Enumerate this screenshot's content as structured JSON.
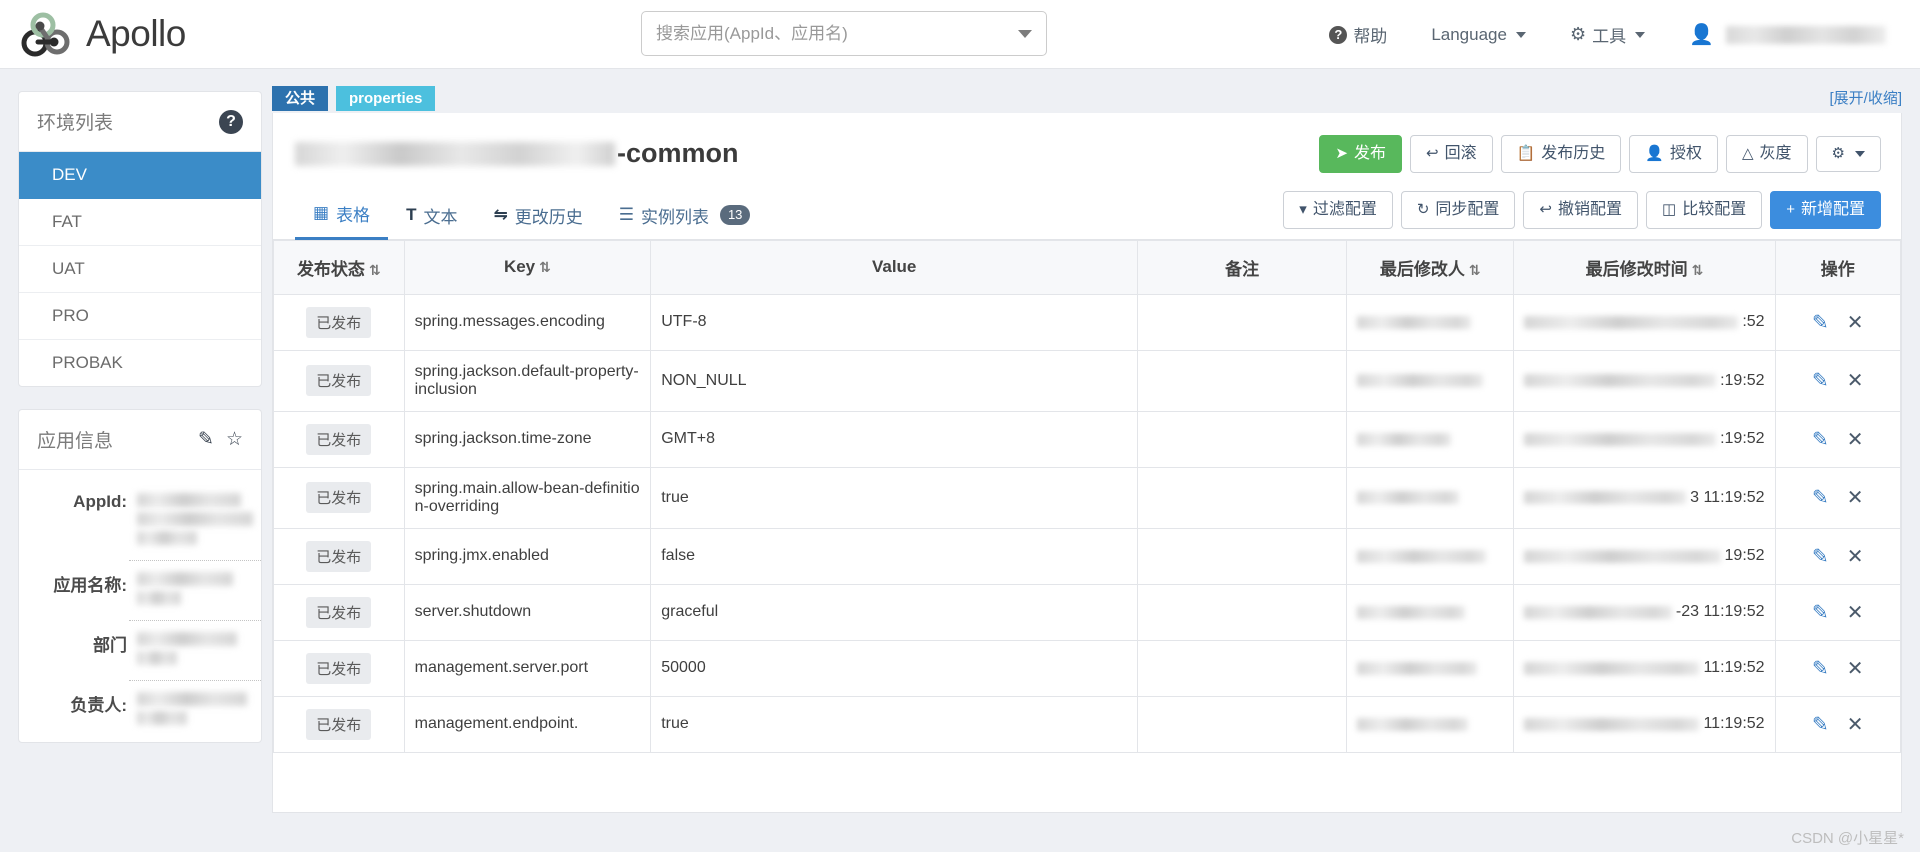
{
  "header": {
    "brand": "Apollo",
    "search_placeholder": "搜索应用(AppId、应用名)",
    "search_value": "",
    "help": "帮助",
    "language": "Language",
    "tools": "工具"
  },
  "sidebar": {
    "env_panel_title": "环境列表",
    "environments": [
      {
        "label": "DEV",
        "active": true
      },
      {
        "label": "FAT",
        "active": false
      },
      {
        "label": "UAT",
        "active": false
      },
      {
        "label": "PRO",
        "active": false
      },
      {
        "label": "PROBAK",
        "active": false
      }
    ],
    "app_panel_title": "应用信息",
    "app_info": [
      {
        "label": "AppId:",
        "value": ""
      },
      {
        "label": "应用名称:",
        "value": ""
      },
      {
        "label": "部门",
        "value": ""
      },
      {
        "label": "负责人:",
        "value": ""
      }
    ]
  },
  "namespace": {
    "tag_public": "公共",
    "tag_format": "properties",
    "expand_link": "[展开/收缩]",
    "title_suffix": "-common",
    "actions": [
      {
        "label": "发布",
        "icon": "send-icon",
        "style": "green"
      },
      {
        "label": "回滚",
        "icon": "rollback-icon",
        "style": "default"
      },
      {
        "label": "发布历史",
        "icon": "history-icon",
        "style": "default"
      },
      {
        "label": "授权",
        "icon": "user-icon",
        "style": "default"
      },
      {
        "label": "灰度",
        "icon": "gray-release-icon",
        "style": "default"
      }
    ],
    "settings_icon": "gear-icon"
  },
  "tabs": [
    {
      "label": "表格",
      "icon": "table-icon",
      "active": true,
      "badge": ""
    },
    {
      "label": "文本",
      "icon": "text-icon",
      "active": false,
      "badge": ""
    },
    {
      "label": "更改历史",
      "icon": "change-history-icon",
      "active": false,
      "badge": ""
    },
    {
      "label": "实例列表",
      "icon": "instance-icon",
      "active": false,
      "badge": "13"
    }
  ],
  "toolbar": [
    {
      "label": "过滤配置",
      "icon": "filter-icon",
      "style": "default"
    },
    {
      "label": "同步配置",
      "icon": "sync-icon",
      "style": "default"
    },
    {
      "label": "撤销配置",
      "icon": "undo-icon",
      "style": "default"
    },
    {
      "label": "比较配置",
      "icon": "compare-icon",
      "style": "default"
    },
    {
      "label": "新增配置",
      "icon": "plus-icon",
      "style": "blue"
    }
  ],
  "table": {
    "columns": [
      {
        "label": "发布状态",
        "sortable": true
      },
      {
        "label": "Key",
        "sortable": true
      },
      {
        "label": "Value",
        "sortable": false
      },
      {
        "label": "备注",
        "sortable": false
      },
      {
        "label": "最后修改人",
        "sortable": true
      },
      {
        "label": "最后修改时间",
        "sortable": true
      },
      {
        "label": "操作",
        "sortable": false
      }
    ],
    "status_label": "已发布",
    "rows": [
      {
        "status": "已发布",
        "key": "spring.messages.encoding",
        "value": "UTF-8",
        "comment": "",
        "modifier": "",
        "time": ":52"
      },
      {
        "status": "已发布",
        "key": "spring.jackson.default-property-inclusion",
        "value": "NON_NULL",
        "comment": "",
        "modifier": "",
        "time": ":19:52"
      },
      {
        "status": "已发布",
        "key": "spring.jackson.time-zone",
        "value": "GMT+8",
        "comment": "",
        "modifier": "",
        "time": ":19:52"
      },
      {
        "status": "已发布",
        "key": "spring.main.allow-bean-definition-overriding",
        "value": "true",
        "comment": "",
        "modifier": "",
        "time": "3 11:19:52"
      },
      {
        "status": "已发布",
        "key": "spring.jmx.enabled",
        "value": "false",
        "comment": "",
        "modifier": "",
        "time": "19:52"
      },
      {
        "status": "已发布",
        "key": "server.shutdown",
        "value": "graceful",
        "comment": "",
        "modifier": "",
        "time": "-23 11:19:52"
      },
      {
        "status": "已发布",
        "key": "management.server.port",
        "value": "50000",
        "comment": "",
        "modifier": "",
        "time": "11:19:52"
      },
      {
        "status": "已发布",
        "key": "management.endpoint.",
        "value": "true",
        "comment": "",
        "modifier": "",
        "time": "11:19:52"
      }
    ],
    "edit_icon": "edit-icon",
    "delete_icon": "delete-icon"
  },
  "watermark": "CSDN @小星星*"
}
